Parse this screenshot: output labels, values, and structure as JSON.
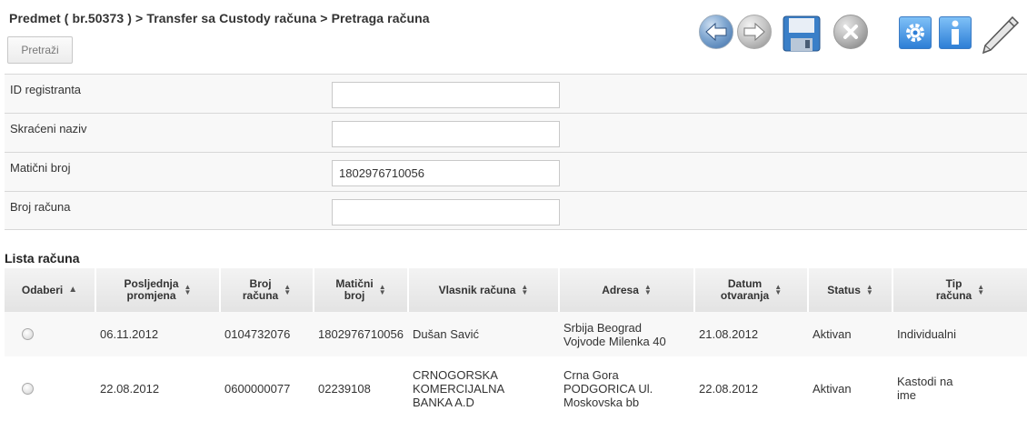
{
  "header": {
    "breadcrumb": "Predmet ( br.50373 ) > Transfer sa Custody računa > Pretraga računa",
    "search_button": "Pretraži"
  },
  "toolbar": {
    "icons": [
      "back-arrow-icon",
      "forward-arrow-icon",
      "save-icon",
      "delete-icon",
      "settings-icon",
      "info-icon",
      "pen-icon"
    ],
    "colors": {
      "back": "#3d6ea8",
      "square": "#2d7ed6"
    }
  },
  "form": {
    "fields": [
      {
        "label": "ID registranta",
        "value": ""
      },
      {
        "label": "Skraćeni naziv",
        "value": ""
      },
      {
        "label": "Matični broj",
        "value": "1802976710056"
      },
      {
        "label": "Broj računa",
        "value": ""
      }
    ]
  },
  "list": {
    "title": "Lista računa",
    "columns": [
      {
        "line1": "Odaberi",
        "line2": ""
      },
      {
        "line1": "Posljednja",
        "line2": "promjena"
      },
      {
        "line1": "Broj",
        "line2": "računa"
      },
      {
        "line1": "Matični",
        "line2": "broj"
      },
      {
        "line1": "Vlasnik računa",
        "line2": ""
      },
      {
        "line1": "Adresa",
        "line2": ""
      },
      {
        "line1": "Datum",
        "line2": "otvaranja"
      },
      {
        "line1": "Status",
        "line2": ""
      },
      {
        "line1": "Tip",
        "line2": "računa"
      }
    ],
    "rows": [
      {
        "date_changed": "06.11.2012",
        "account_no": "0104732076",
        "reg_no": "1802976710056",
        "owner": [
          "Dušan Savić"
        ],
        "address": [
          "Srbija Beograd",
          "Vojvode Milenka 40"
        ],
        "date_opened": "21.08.2012",
        "status": "Aktivan",
        "type": [
          "Individualni"
        ]
      },
      {
        "date_changed": "22.08.2012",
        "account_no": "0600000077",
        "reg_no": "02239108",
        "owner": [
          "CRNOGORSKA",
          "KOMERCIJALNA",
          "BANKA A.D"
        ],
        "address": [
          "Crna Gora",
          "PODGORICA Ul.",
          "Moskovska bb"
        ],
        "date_opened": "22.08.2012",
        "status": "Aktivan",
        "type": [
          "Kastodi na",
          "ime"
        ]
      }
    ]
  }
}
